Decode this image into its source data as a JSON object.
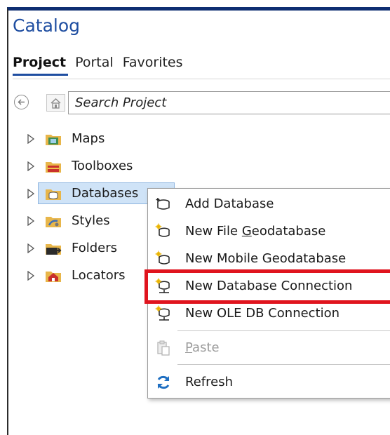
{
  "pane": {
    "title": "Catalog"
  },
  "tabs": [
    {
      "label": "Project",
      "active": true
    },
    {
      "label": "Portal",
      "active": false
    },
    {
      "label": "Favorites",
      "active": false
    }
  ],
  "search": {
    "placeholder": "Search Project"
  },
  "tree": {
    "items": [
      {
        "label": "Maps",
        "icon": "maps-folder-icon"
      },
      {
        "label": "Toolboxes",
        "icon": "toolboxes-folder-icon"
      },
      {
        "label": "Databases",
        "icon": "databases-folder-icon",
        "selected": true
      },
      {
        "label": "Styles",
        "icon": "styles-folder-icon"
      },
      {
        "label": "Folders",
        "icon": "folders-folder-icon"
      },
      {
        "label": "Locators",
        "icon": "locators-folder-icon"
      }
    ]
  },
  "context_menu": {
    "items": [
      {
        "label": "Add Database",
        "icon": "add-database-icon"
      },
      {
        "label_pre": "New File ",
        "label_u": "G",
        "label_post": "eodatabase",
        "icon": "new-file-geodatabase-icon"
      },
      {
        "label": "New Mobile Geodatabase",
        "icon": "new-mobile-geodatabase-icon"
      },
      {
        "label": "New Database Connection",
        "icon": "new-database-connection-icon",
        "highlighted": true
      },
      {
        "label": "New OLE DB Connection",
        "icon": "new-ole-db-connection-icon"
      },
      {
        "label_u": "P",
        "label_post": "aste",
        "icon": "paste-icon",
        "disabled": true
      },
      {
        "label": "Refresh",
        "icon": "refresh-icon"
      }
    ]
  },
  "colors": {
    "accent": "#1f4ea1",
    "title_bar": "#0f2f72",
    "selection": "#cfe3f7",
    "callout": "#e0141e"
  }
}
